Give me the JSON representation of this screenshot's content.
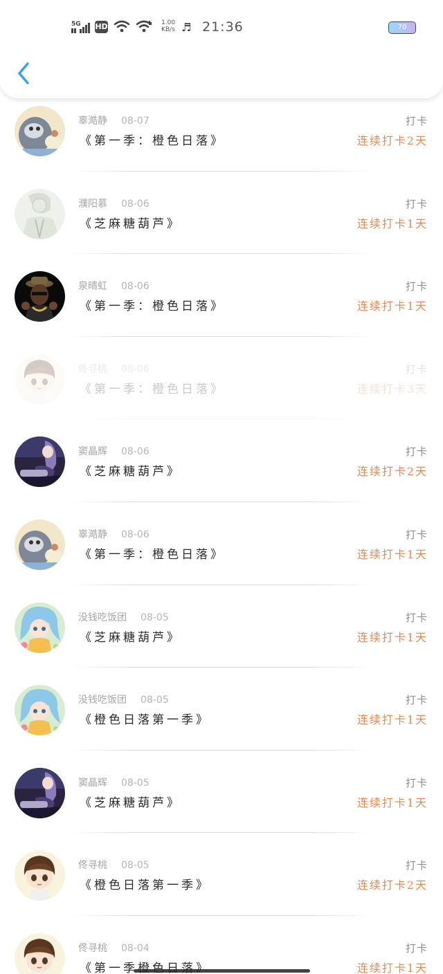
{
  "status_bar": {
    "network": "5G",
    "hd": "HD",
    "speed_value": "1.00",
    "speed_unit": "KB/s",
    "time": "21:36",
    "battery": "70"
  },
  "header": {
    "back_icon": "chevron-left-icon",
    "accent_color": "#2fa4e7"
  },
  "colors": {
    "streak": "#e58a51",
    "checkin": "#8e8e8e",
    "title": "#2b2b2b"
  },
  "items": [
    {
      "user": "辜澔静",
      "date": "08-07",
      "book": "《第一季：橙色日落》",
      "checkin": "打卡",
      "streak": "连续打卡2天",
      "avatar": "cartoon-cat-avatar"
    },
    {
      "user": "濮阳慕",
      "date": "08-06",
      "book": "《芝麻糖葫芦》",
      "checkin": "打卡",
      "streak": "连续打卡1天",
      "avatar": "sketch-man-avatar"
    },
    {
      "user": "泉晴虹",
      "date": "08-06",
      "book": "《第一季：橙色日落》",
      "checkin": "打卡",
      "streak": "连续打卡1天",
      "avatar": "rapper-avatar"
    },
    {
      "user": "佟寻桃",
      "date": "08-06",
      "book": "《第一季：橙色日落》",
      "checkin": "打卡",
      "streak": "连续打卡3天",
      "avatar": "chibi-boy-avatar"
    },
    {
      "user": "窦晶辉",
      "date": "08-06",
      "book": "《芝麻糖葫芦》",
      "checkin": "打卡",
      "streak": "连续打卡2天",
      "avatar": "anime-girl-purple-avatar"
    },
    {
      "user": "辜澔静",
      "date": "08-06",
      "book": "《第一季：橙色日落》",
      "checkin": "打卡",
      "streak": "连续打卡1天",
      "avatar": "cartoon-cat-avatar"
    },
    {
      "user": "没钱吃饭团",
      "date": "08-05",
      "book": "《芝麻糖葫芦》",
      "checkin": "打卡",
      "streak": "连续打卡1天",
      "avatar": "anime-girl-blue-avatar"
    },
    {
      "user": "没钱吃饭团",
      "date": "08-05",
      "book": "《橙色日落第一季》",
      "checkin": "打卡",
      "streak": "连续打卡1天",
      "avatar": "anime-girl-blue-avatar"
    },
    {
      "user": "窦晶辉",
      "date": "08-05",
      "book": "《芝麻糖葫芦》",
      "checkin": "打卡",
      "streak": "连续打卡1天",
      "avatar": "anime-girl-purple-avatar"
    },
    {
      "user": "佟寻桃",
      "date": "08-05",
      "book": "《橙色日落第一季》",
      "checkin": "打卡",
      "streak": "连续打卡2天",
      "avatar": "chibi-boy-avatar"
    },
    {
      "user": "佟寻桃",
      "date": "08-04",
      "book": "《第一季橙色日落》",
      "checkin": "打卡",
      "streak": "连续打卡1天",
      "avatar": "chibi-boy-avatar"
    }
  ]
}
